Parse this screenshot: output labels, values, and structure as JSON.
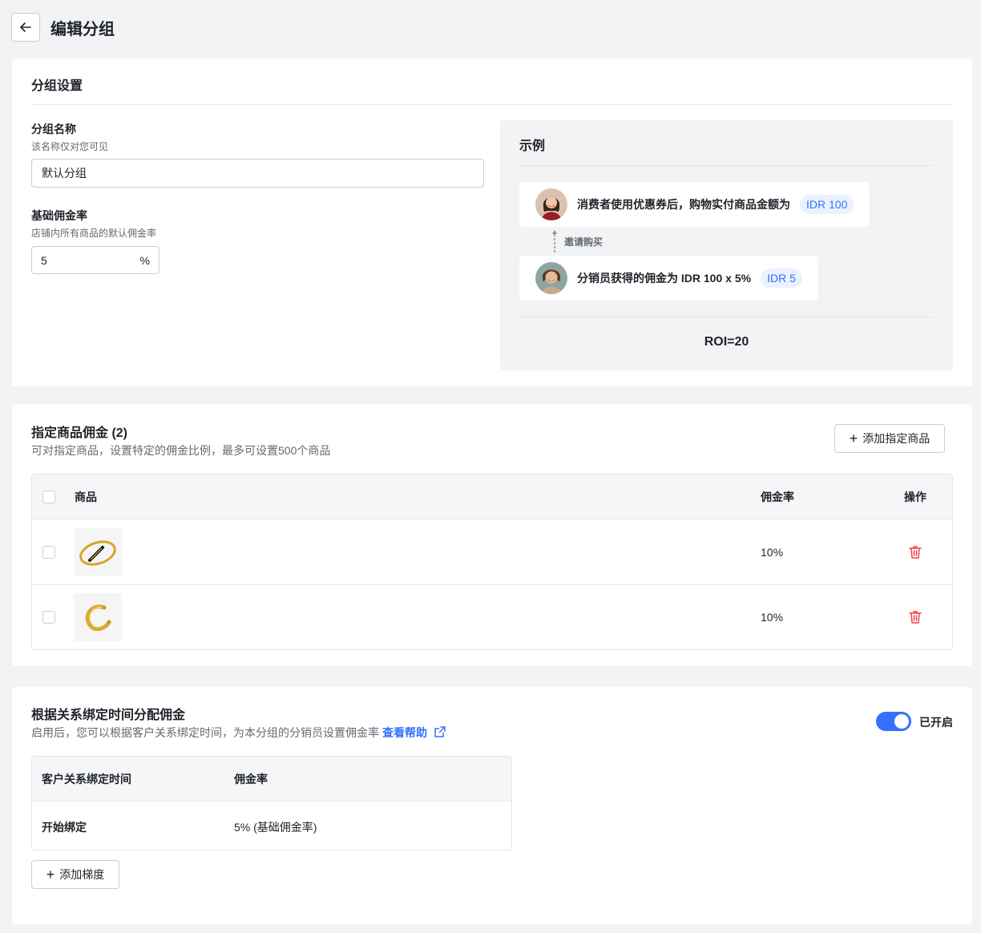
{
  "header": {
    "title": "编辑分组"
  },
  "group_settings": {
    "section_title": "分组设置",
    "name_label": "分组名称",
    "name_help": "该名称仅对您可见",
    "name_value": "默认分组",
    "base_rate_label": "基础佣金率",
    "base_rate_help": "店铺内所有商品的默认佣金率",
    "base_rate_value": "5",
    "base_rate_suffix": "%"
  },
  "example": {
    "title": "示例",
    "consumer_text": "消费者使用优惠券后，购物实付商品金额为",
    "consumer_tag": "IDR 100",
    "invite_text": "邀请购买",
    "affiliate_text": "分销员获得的佣金为 IDR 100 x 5%",
    "affiliate_tag": "IDR 5",
    "roi": "ROI=20"
  },
  "product_commission": {
    "title": "指定商品佣金 (2)",
    "desc": "可对指定商品，设置特定的佣金比例，最多可设置500个商品",
    "add_button": "添加指定商品",
    "columns": {
      "product": "商品",
      "rate": "佣金率",
      "action": "操作"
    },
    "rows": [
      {
        "rate": "10%",
        "thumb_icon": "bracelet-image"
      },
      {
        "rate": "10%",
        "thumb_icon": "cuff-bracelet-image"
      }
    ]
  },
  "time_commission": {
    "title": "根据关系绑定时间分配佣金",
    "desc": "启用后，您可以根据客户关系绑定时间，为本分组的分销员设置佣金率",
    "help_link": "查看帮助",
    "toggle_label": "已开启",
    "toggle_on": true,
    "columns": {
      "bind_time": "客户关系绑定时间",
      "rate": "佣金率"
    },
    "rows": [
      {
        "bind_time": "开始绑定",
        "rate": "5% (基础佣金率)"
      }
    ],
    "add_button": "添加梯度"
  },
  "colors": {
    "accent": "#3370ff",
    "danger": "#f53f3f",
    "tag_bg": "#eaf2ff"
  }
}
